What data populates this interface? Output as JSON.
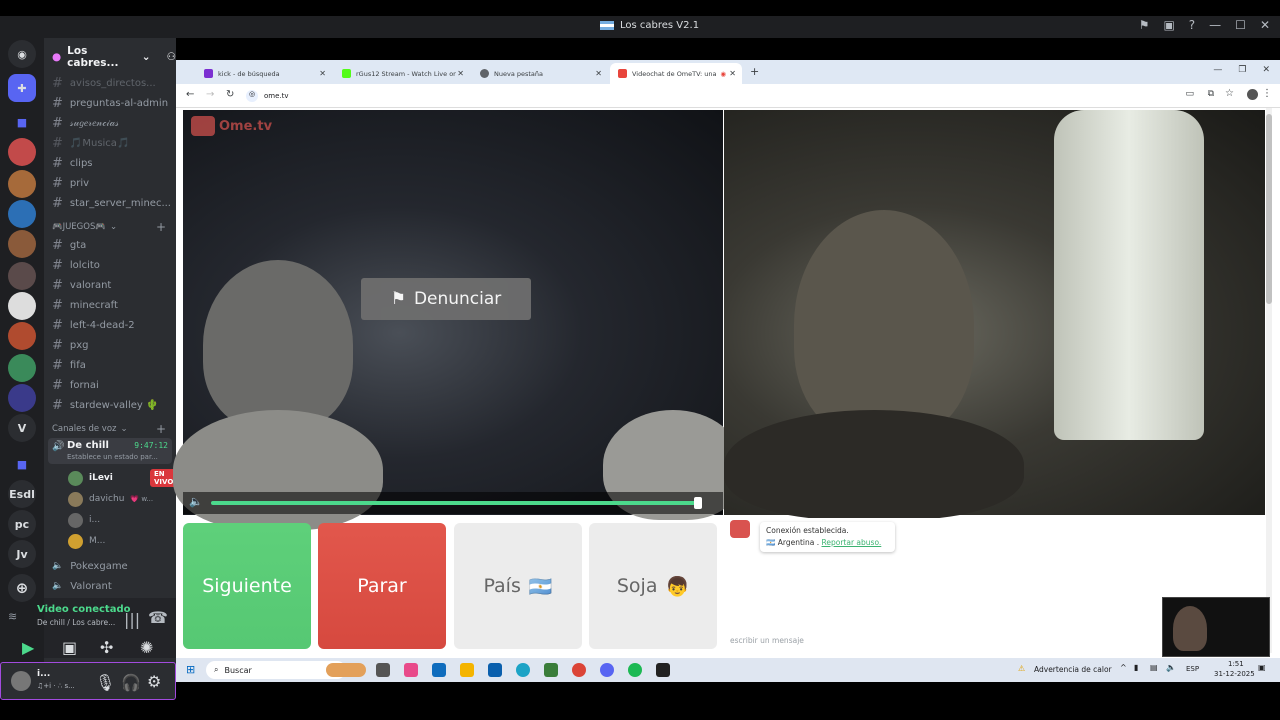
{
  "window": {
    "title": "Los cabres V2.1"
  },
  "discord": {
    "server_name": "Los cabres...",
    "rail": {
      "text_items": [
        "V",
        "Esdl",
        "pc",
        "Jv"
      ]
    },
    "channels": [
      {
        "name": "avisos_directos..."
      },
      {
        "name": "preguntas-al-admin"
      },
      {
        "name": "𝓈𝓊𝑔𝑒𝓇𝑒𝓃𝒸𝒾𝒶𝓈"
      },
      {
        "name": "🎵Musica🎵"
      },
      {
        "name": "clips"
      },
      {
        "name": "priv"
      },
      {
        "name": "star_server_minec..."
      }
    ],
    "games_category": "🎮JUEGOS🎮",
    "game_channels": [
      "gta",
      "lolcito",
      "valorant",
      "minecraft",
      "left-4-dead-2",
      "pxg",
      "fifa",
      "fornai",
      "stardew-valley 🌵"
    ],
    "voice_category": "Canales de voz",
    "voice_channel": {
      "name": "De chill",
      "timer": "9:47:12",
      "status": "Establece un estado par..."
    },
    "voice_users": [
      {
        "name": "iLevi",
        "badge": "EN VIVO"
      },
      {
        "name": "davichu",
        "badge": "💗 w..."
      },
      {
        "name": "i..."
      },
      {
        "name": "M..."
      }
    ],
    "other_voice": [
      "Pokexgame",
      "Valorant"
    ],
    "connection": {
      "title": "Video conectado",
      "subtitle": "De chill / Los cabre..."
    },
    "user_panel": {
      "name": "i...",
      "status": "♫+i · ∴ s..."
    }
  },
  "browser": {
    "tabs": [
      {
        "label": "kick - de búsqueda",
        "color": "#7b2fd1"
      },
      {
        "label": "rGus12 Stream - Watch Live on...",
        "color": "#53fc18"
      },
      {
        "label": "Nueva pestaña",
        "color": "#5f6368"
      },
      {
        "label": "Videochat de OmeTV: una...",
        "color": "#e8453c"
      }
    ],
    "url": "ome.tv"
  },
  "ometv": {
    "logo": "Ome.tv",
    "report_label": "Denunciar",
    "volume_level": 0.97,
    "buttons": {
      "next": "Siguiente",
      "stop": "Parar",
      "country": "País",
      "country_icon": "🇦🇷",
      "gender": "Soja",
      "gender_icon": "👦"
    },
    "chat": {
      "status": "Conexión establecida.",
      "country": "Argentina",
      "separator": " .",
      "report_link": "Reportar abuso.",
      "input_placeholder": "escribir un mensaje"
    }
  },
  "taskbar": {
    "search_placeholder": "Buscar",
    "weather": "Advertencia de calor",
    "lang": "ESP",
    "time": "1:51",
    "date": "31-12-2025"
  },
  "colors": {
    "next": "#5ed07a",
    "stop": "#e2574c",
    "neutral": "#e6e6e6",
    "accent": "#4cd98c"
  }
}
